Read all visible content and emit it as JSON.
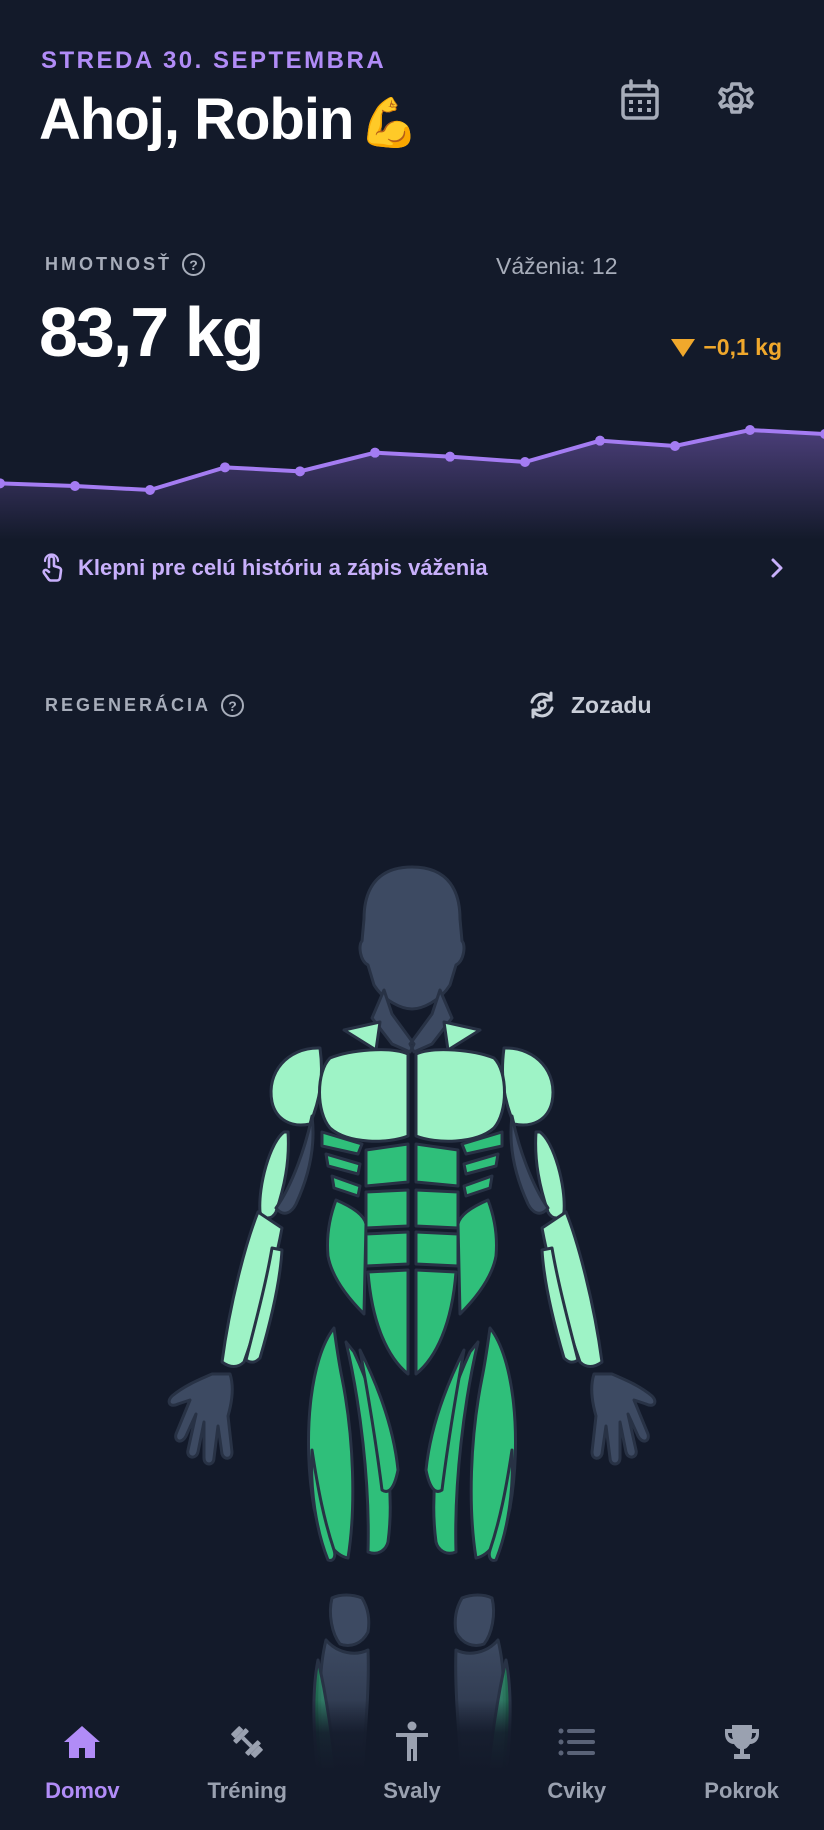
{
  "header": {
    "date": "STREDA 30. SEPTEMBRA",
    "greeting": "Ahoj, Robin",
    "greeting_emoji": "💪",
    "calendar_icon": "calendar-icon",
    "settings_icon": "gear-icon"
  },
  "weight": {
    "label": "HMOTNOSŤ",
    "help": "?",
    "weighings": "Váženia: 12",
    "value": "83,7 kg",
    "delta": "−0,1 kg",
    "delta_color": "#f0a82c",
    "history_link": "Klepni pre celú históriu a zápis váženia"
  },
  "chart_data": {
    "type": "line",
    "series": [
      {
        "values": [
          83.4,
          83.38,
          83.35,
          83.52,
          83.49,
          83.63,
          83.6,
          83.56,
          83.72,
          83.68,
          83.8,
          83.77
        ]
      }
    ],
    "line_color": "#a47cf2",
    "grid": false
  },
  "regeneration": {
    "label": "REGENERÁCIA",
    "help": "?",
    "rotate_label": "Zozadu",
    "muscle_colors": {
      "recovered_light": "#9ef3c6",
      "recovered": "#2fbf7a",
      "inactive": "#3d4a62"
    }
  },
  "nav": {
    "items": [
      {
        "label": "Domov",
        "icon": "home-icon",
        "active": true
      },
      {
        "label": "Tréning",
        "icon": "dumbbell-icon",
        "active": false
      },
      {
        "label": "Svaly",
        "icon": "person-icon",
        "active": false
      },
      {
        "label": "Cviky",
        "icon": "list-icon",
        "active": false
      },
      {
        "label": "Pokrok",
        "icon": "trophy-icon",
        "active": false
      }
    ]
  }
}
